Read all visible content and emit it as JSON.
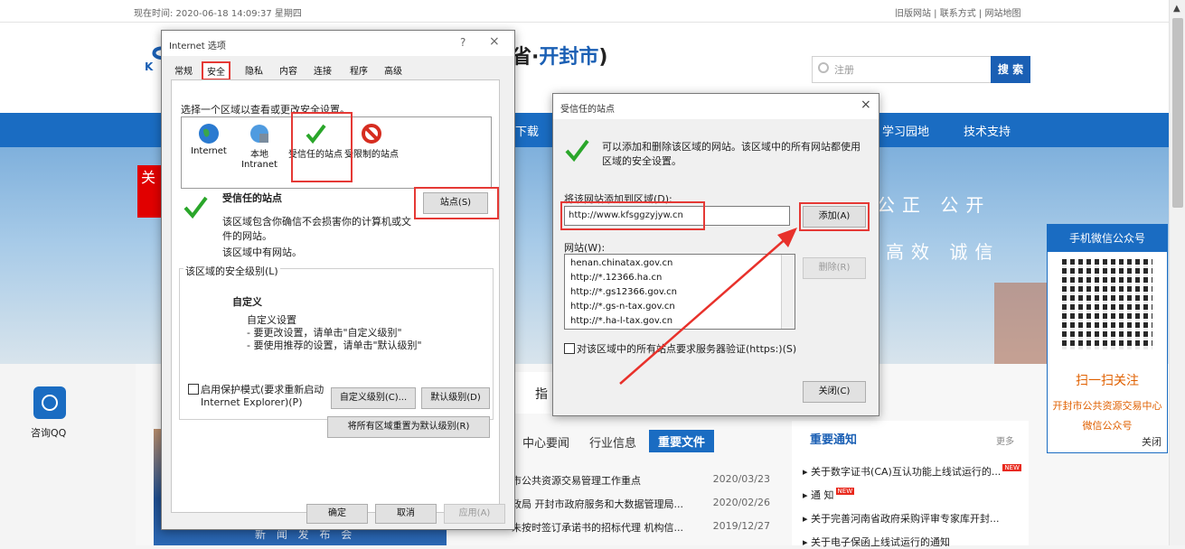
{
  "page": {
    "time_text": "现在时间: 2020-06-18 14:09:37 星期四",
    "top_links": "旧版网站 | 联系方式 | 网站地图",
    "region_prefix": "省·",
    "region_city": "开封市",
    "region_suffix": ")",
    "search_placeholder": "注册",
    "search_button": "搜 索",
    "nav_items": [
      "下载",
      "学习园地",
      "技术支持"
    ],
    "slogan_line1": "公正 公开",
    "slogan_line2": "高效 诚信",
    "red_box_char": "关",
    "qq_label": "咨询QQ",
    "feature_text": "指",
    "wechat": {
      "header": "手机微信公众号",
      "scan": "扫一扫关注",
      "org": "开封市公共资源交易中心",
      "pub": "微信公众号",
      "close": "关闭"
    },
    "news": {
      "tabs": [
        "中心要闻",
        "行业信息",
        "重要文件"
      ],
      "rows": [
        {
          "title": "市公共资源交易管理工作重点",
          "date": "2020/03/23"
        },
        {
          "title": "政局 开封市政府服务和大数据管理局...",
          "date": "2020/02/26"
        },
        {
          "title": "未按时签订承诺书的招标代理 机构信...",
          "date": "2019/12/27"
        }
      ]
    },
    "notice": {
      "title": "重要通知",
      "more": "更多",
      "rows": [
        "关于数字证书(CA)互认功能上线试运行的...",
        "通 知",
        "关于完善河南省政府采购评审专家库开封...",
        "关于电子保函上线试运行的通知"
      ],
      "new_badge": "NEW"
    },
    "photo_caption": "新 闻 发 布 会"
  },
  "internet_options": {
    "title": "Internet 选项",
    "help": "?",
    "close": "×",
    "tabs": [
      "常规",
      "安全",
      "隐私",
      "内容",
      "连接",
      "程序",
      "高级"
    ],
    "instruction": "选择一个区域以查看或更改安全设置。",
    "zones": [
      {
        "label": "Internet",
        "icon": "globe-icon"
      },
      {
        "label": "本地 Intranet",
        "icon": "intranet-icon"
      },
      {
        "label": "受信任的站点",
        "icon": "checkmark-icon"
      },
      {
        "label": "受限制的站点",
        "icon": "restricted-icon"
      }
    ],
    "zone_title": "受信任的站点",
    "zone_desc": "该区域包含你确信不会损害你的计算机或文件的网站。",
    "zone_has_sites": "该区域中有网站。",
    "sites_button": "站点(S)",
    "level_group": "该区域的安全级别(L)",
    "level_name": "自定义",
    "level_custom": "自定义设置",
    "level_hint1": "- 要更改设置，请单击\"自定义级别\"",
    "level_hint2": "- 要使用推荐的设置，请单击\"默认级别\"",
    "protected_mode": "启用保护模式(要求重新启动 Internet Explorer)(P)",
    "custom_level_button": "自定义级别(C)...",
    "default_level_button": "默认级别(D)",
    "reset_all_button": "将所有区域重置为默认级别(R)",
    "ok": "确定",
    "cancel": "取消",
    "apply": "应用(A)"
  },
  "trusted_sites": {
    "title": "受信任的站点",
    "close": "×",
    "info": "可以添加和删除该区域的网站。该区域中的所有网站都使用区域的安全设置。",
    "add_label": "将该网站添加到区域(D):",
    "add_value": "http://www.kfsggzyjyw.cn",
    "add_button": "添加(A)",
    "sites_label": "网站(W):",
    "sites": [
      "henan.chinatax.gov.cn",
      "http://*.12366.ha.cn",
      "http://*.gs12366.gov.cn",
      "http://*.gs-n-tax.gov.cn",
      "http://*.ha-l-tax.gov.cn"
    ],
    "remove_button": "删除(R)",
    "https_label": "对该区域中的所有站点要求服务器验证(https:)(S)",
    "close_button": "关闭(C)"
  },
  "colors": {
    "accent": "#1a6cc2",
    "highlight": "#e53935",
    "arrow": "#e8312b"
  }
}
